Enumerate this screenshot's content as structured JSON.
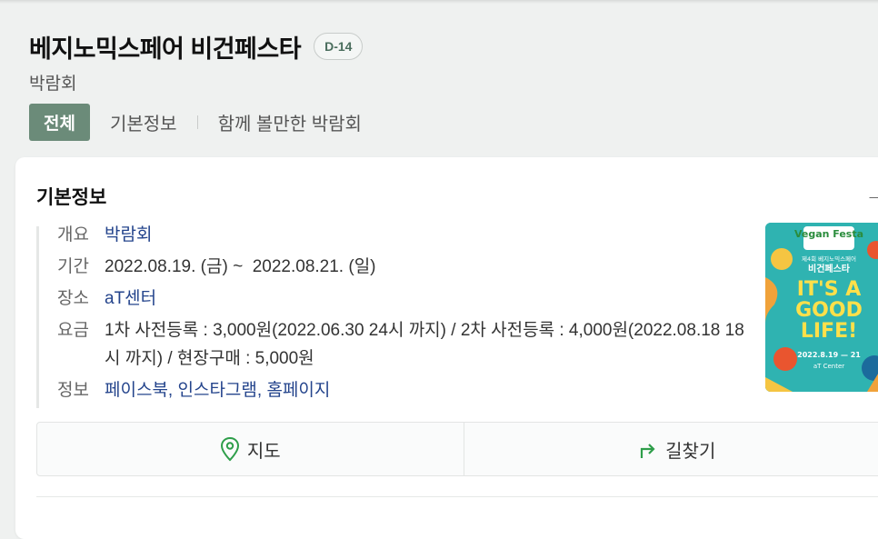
{
  "header": {
    "title": "베지노믹스페어 비건페스타",
    "dday": "D-14",
    "subtitle": "박람회"
  },
  "tabs": {
    "all": "전체",
    "basic": "기본정보",
    "related": "함께 볼만한 박람회"
  },
  "card": {
    "title": "기본정보",
    "arrow": "→",
    "rows": {
      "overview": {
        "label": "개요",
        "value": "박람회"
      },
      "period": {
        "label": "기간",
        "value": "2022.08.19. (금) ~  2022.08.21. (일)"
      },
      "place": {
        "label": "장소",
        "value": "aT센터"
      },
      "fee": {
        "label": "요금",
        "value": "1차 사전등록 : 3,000원(2022.06.30 24시 까지) / 2차 사전등록 : 4,000원(2022.08.18 18시 까지) / 현장구매 : 5,000원"
      },
      "info": {
        "label": "정보",
        "links": [
          "페이스북",
          "인스타그램",
          "홈페이지"
        ],
        "sep": ", "
      }
    },
    "poster": {
      "top_logo": "Vegan Festa",
      "subline": "제4회 베지노믹스페어",
      "name": "비건페스타",
      "slogan1": "IT'S A",
      "slogan2": "GOOD",
      "slogan3": "LIFE!",
      "date": "2022.8.19 — 21",
      "venue": "aT Center"
    },
    "buttons": {
      "map": "지도",
      "directions": "길찾기"
    }
  },
  "colors": {
    "accent_green": "#6b8b79",
    "link_blue": "#24448c",
    "icon_green": "#2e9e4a"
  }
}
